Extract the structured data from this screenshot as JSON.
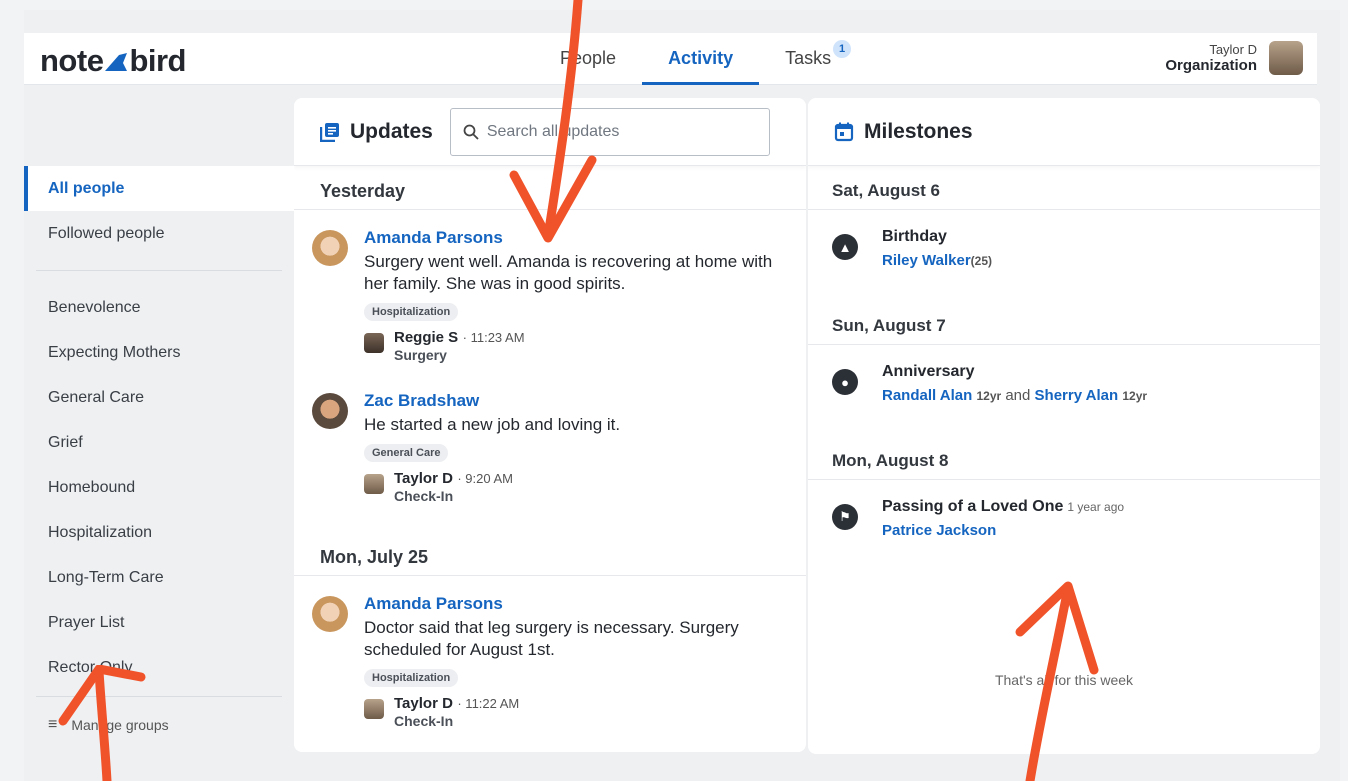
{
  "app": {
    "logo": "note bird",
    "logo_left": "note",
    "logo_right": "bird"
  },
  "nav": {
    "tabs": [
      {
        "label": "People",
        "active": false
      },
      {
        "label": "Activity",
        "active": true
      },
      {
        "label": "Tasks",
        "active": false,
        "badge": "1"
      }
    ]
  },
  "user": {
    "name": "Taylor D",
    "org": "Organization"
  },
  "sidebar": {
    "primary": [
      {
        "label": "All people",
        "active": true
      },
      {
        "label": "Followed people",
        "active": false
      }
    ],
    "groups": [
      "Benevolence",
      "Expecting Mothers",
      "General Care",
      "Grief",
      "Homebound",
      "Hospitalization",
      "Long-Term Care",
      "Prayer List",
      "Rector Only"
    ],
    "manage_label": "Manage groups"
  },
  "updates": {
    "title": "Updates",
    "search_placeholder": "Search all updates",
    "days": [
      {
        "label": "Yesterday",
        "items": [
          {
            "name": "Amanda Parsons",
            "text": "Surgery went well. Amanda is recovering at home with her family. She was in good spirits.",
            "tag": "Hospitalization",
            "author": "Reggie S",
            "time": "· 11:23 AM",
            "type": "Surgery"
          },
          {
            "name": "Zac Bradshaw",
            "text": "He started a new job and loving it.",
            "tag": "General Care",
            "author": "Taylor D",
            "time": "· 9:20 AM",
            "type": "Check-In"
          }
        ]
      },
      {
        "label": "Mon, July 25",
        "items": [
          {
            "name": "Amanda Parsons",
            "text": "Doctor said that leg surgery is necessary. Surgery scheduled for August 1st.",
            "tag": "Hospitalization",
            "author": "Taylor D",
            "time": "· 11:22 AM",
            "type": "Check-In"
          }
        ]
      }
    ]
  },
  "milestones": {
    "title": "Milestones",
    "days": [
      {
        "label": "Sat, August 6",
        "title": "Birthday",
        "person": "Riley Walker",
        "detail": "(25)"
      },
      {
        "label": "Sun, August 7",
        "title": "Anniversary",
        "person": "Randall Alan",
        "detail": "12yr",
        "joiner": "and",
        "person2": "Sherry Alan",
        "detail2": "12yr"
      },
      {
        "label": "Mon, August 8",
        "title": "Passing of a Loved One",
        "ago": "1 year ago",
        "person": "Patrice Jackson"
      }
    ],
    "footer": "That's all for this week"
  },
  "colors": {
    "accent": "#1565c0",
    "annotation": "#f0532a"
  }
}
